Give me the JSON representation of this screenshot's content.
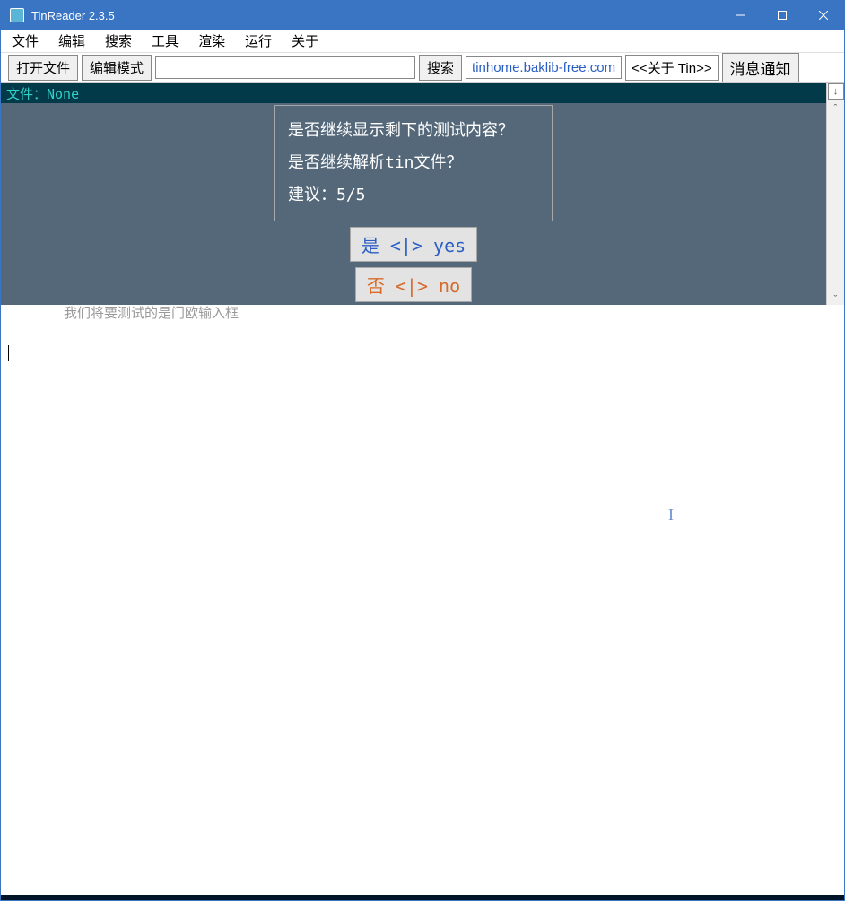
{
  "window": {
    "title": "TinReader 2.3.5"
  },
  "menubar": {
    "items": [
      "文件",
      "编辑",
      "搜索",
      "工具",
      "渲染",
      "运行",
      "关于"
    ]
  },
  "toolbar": {
    "open_file": "打开文件",
    "edit_mode": "编辑模式",
    "search_value": "",
    "search_btn": "搜索",
    "link": "tinhome.baklib-free.com",
    "about_tin": "<<关于 Tin>>",
    "notify": "消息通知"
  },
  "filebar": {
    "text": "文件：None"
  },
  "dialog": {
    "line1": "是否继续显示剩下的测试内容？",
    "line2": "是否继续解析tin文件？",
    "line3": "建议：5/5",
    "yes": "是 <|> yes",
    "no": "否 <|> no"
  },
  "faded": {
    "text": "我们将要测试的是门欧输入框"
  },
  "scroll": {
    "down": "↓",
    "up_caret": "ˆ",
    "down_caret": "ˇ"
  }
}
